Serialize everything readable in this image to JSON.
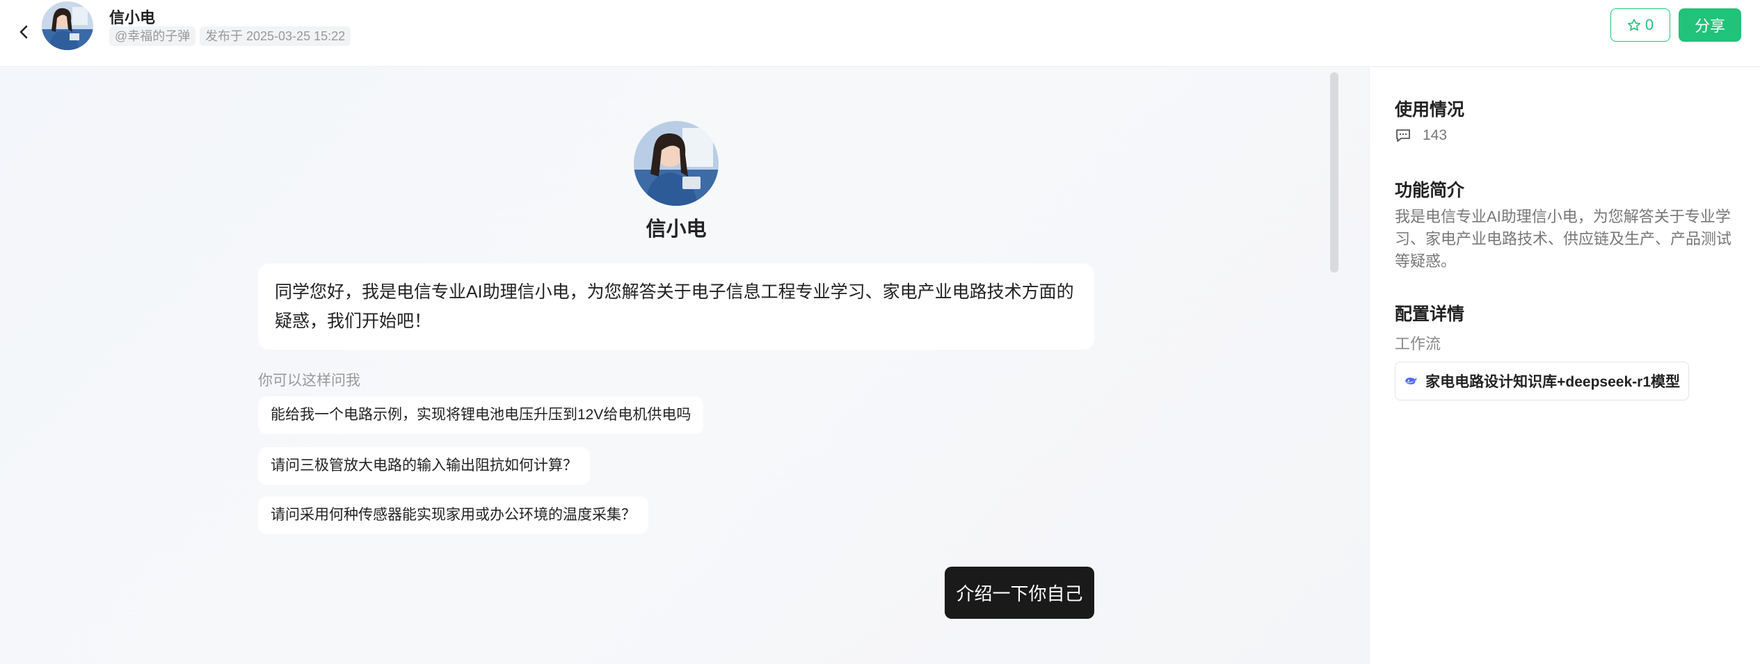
{
  "header": {
    "title": "信小电",
    "author": "@幸福的子弹",
    "published": "发布于 2025-03-25 15:22",
    "star_count": "0",
    "share_label": "分享"
  },
  "chat": {
    "bot_name": "信小电",
    "greeting": "同学您好，我是电信专业AI助理信小电，为您解答关于电子信息工程专业学习、家电产业电路技术方面的疑惑，我们开始吧！",
    "hint": "你可以这样问我",
    "suggestions": [
      "能给我一个电路示例，实现将锂电池电压升压到12V给电机供电吗",
      "请问三极管放大电路的输入输出阻抗如何计算？",
      "请问采用何种传感器能实现家用或办公环境的温度采集？"
    ],
    "user_message": "介绍一下你自己"
  },
  "sidebar": {
    "usage_title": "使用情况",
    "usage_count": "143",
    "intro_title": "功能简介",
    "intro_text": "我是电信专业AI助理信小电，为您解答关于专业学习、家电产业电路技术、供应链及生产、产品测试等疑惑。",
    "config_title": "配置详情",
    "workflow_label": "工作流",
    "workflow_name": "家电电路设计知识库+deepseek-r1模型"
  },
  "colors": {
    "accent": "#21c27a",
    "user_bubble": "#1a1a1a"
  },
  "icons": [
    "back-arrow-icon",
    "star-icon",
    "comment-icon",
    "whale-icon"
  ]
}
